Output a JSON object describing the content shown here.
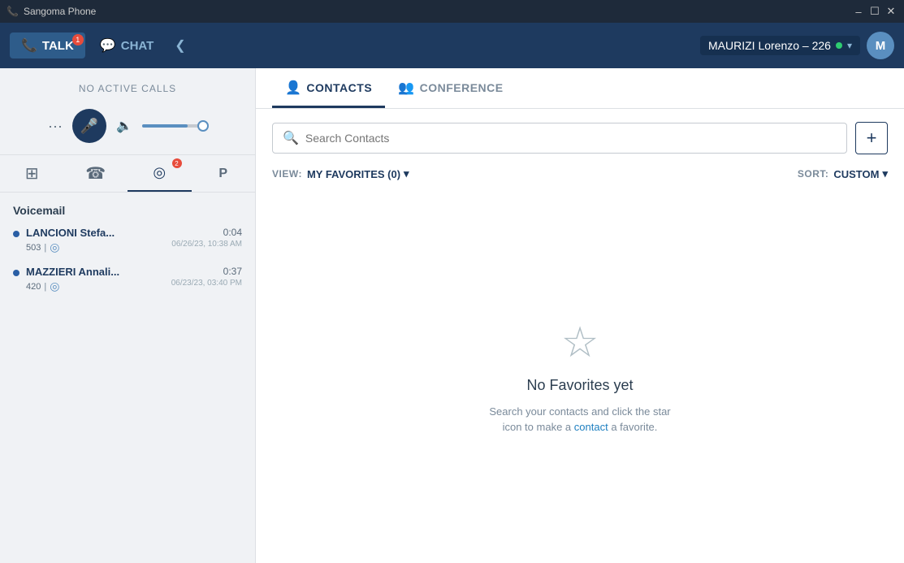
{
  "titlebar": {
    "app_name": "Sangoma Phone",
    "controls": {
      "minimize": "–",
      "maximize": "☐",
      "close": "✕"
    }
  },
  "header": {
    "talk_tab": "TALK",
    "talk_badge": "1",
    "chat_tab": "CHAT",
    "collapse_icon": "❮",
    "user_name": "MAURIZI Lorenzo – 226",
    "avatar_initials": "M"
  },
  "sidebar": {
    "no_active_calls": "NO ACTIVE CALLS",
    "voicemail_title": "Voicemail",
    "voicemail_items": [
      {
        "name": "LANCIONI Stefa...",
        "ext": "503",
        "duration": "0:04",
        "date": "06/26/23, 10:38 AM"
      },
      {
        "name": "MAZZIERI Annali...",
        "ext": "420",
        "duration": "0:37",
        "date": "06/23/23, 03:40 PM"
      }
    ]
  },
  "nav": {
    "dialpad_icon": "⊞",
    "calls_icon": "☎",
    "voicemail_icon": "◎",
    "voicemail_badge": "2",
    "parking_icon": "P"
  },
  "contacts_panel": {
    "tabs": [
      {
        "label": "CONTACTS",
        "icon": "👤",
        "active": true
      },
      {
        "label": "CONFERENCE",
        "icon": "👥",
        "active": false
      }
    ],
    "search_placeholder": "Search Contacts",
    "add_button": "+",
    "view_label": "VIEW:",
    "view_value": "MY FAVORITES (0)",
    "sort_label": "SORT:",
    "sort_value": "CUSTOM",
    "empty_state": {
      "title": "No Favorites yet",
      "description_part1": "Search your contacts and click the star",
      "description_part2": "icon to make a",
      "description_link": "contact",
      "description_part3": "a favorite."
    }
  }
}
